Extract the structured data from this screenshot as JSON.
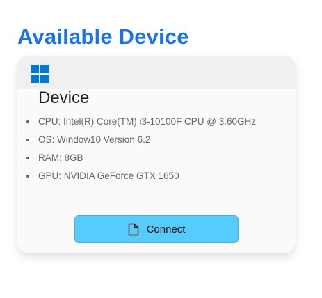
{
  "page": {
    "title": "Available Device"
  },
  "device": {
    "os_icon": "windows-logo-icon",
    "name": "Device",
    "specs": [
      "CPU: Intel(R) Core(TM) i3-10100F CPU @ 3.60GHz",
      "OS: Window10 Version 6.2",
      "RAM: 8GB",
      "GPU: NVIDIA GeForce GTX 1650"
    ],
    "connect_label": "Connect",
    "connect_icon": "file-icon"
  },
  "colors": {
    "title": "#1a73e8",
    "windows_logo": "#0078d4",
    "button_bg": "#56ccfc",
    "card_bg": "#fafafa",
    "header_bg": "#f0f0f0"
  }
}
